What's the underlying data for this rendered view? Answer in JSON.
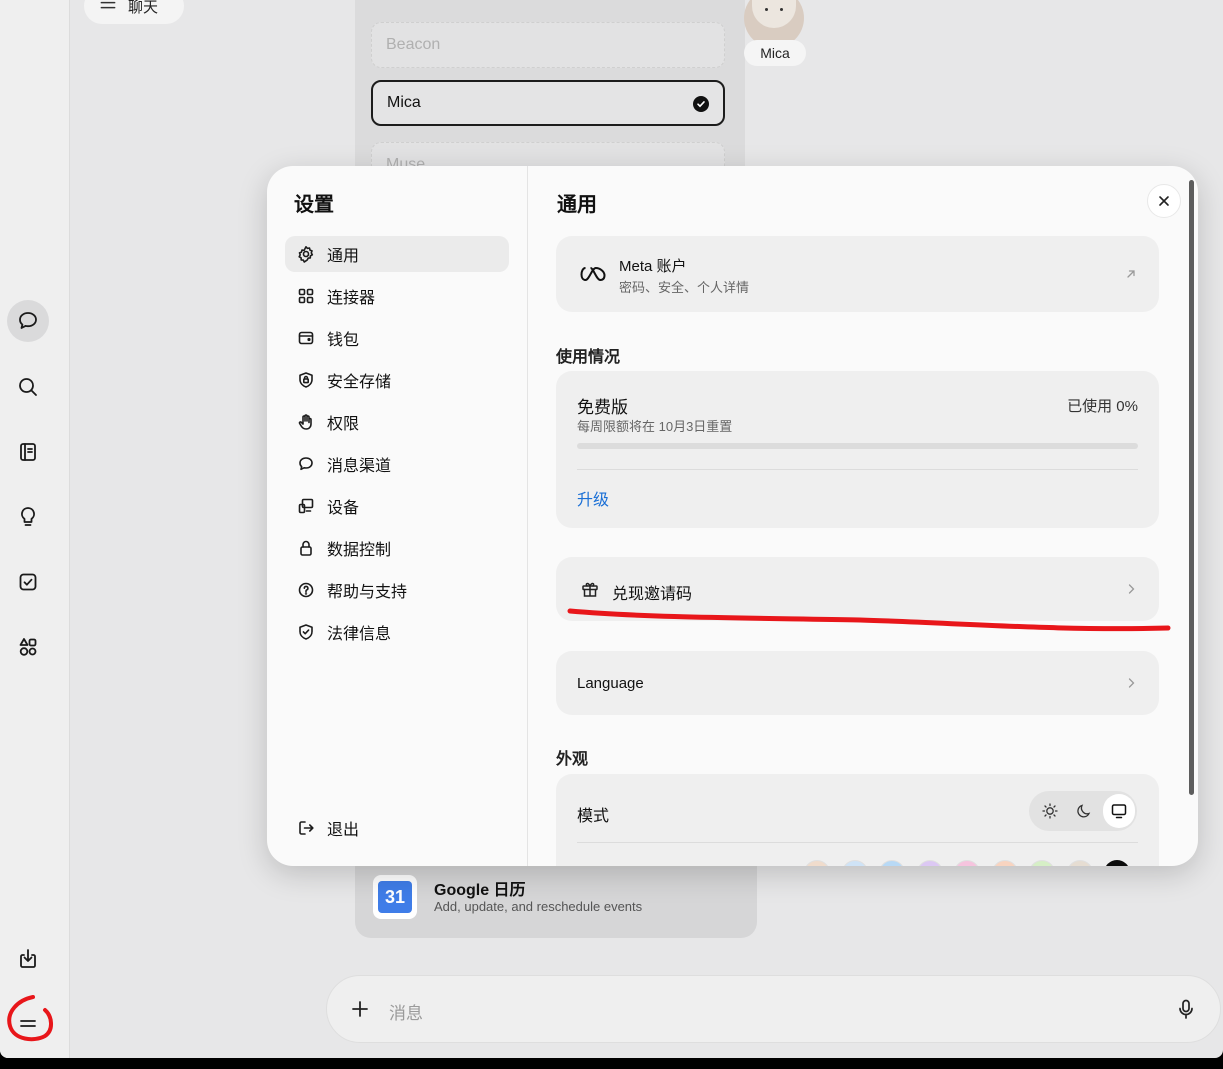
{
  "topbar": {
    "chat_label": "聊天"
  },
  "voices": {
    "options": [
      {
        "name": "Beacon"
      },
      {
        "name": "Mica"
      },
      {
        "name": "Muse"
      }
    ],
    "avatar_name": "Mica"
  },
  "connector_card": {
    "icon_text": "31",
    "title": "Google 日历",
    "subtitle": "Add, update, and reschedule events"
  },
  "composer": {
    "placeholder": "消息"
  },
  "settings": {
    "title": "设置",
    "nav": [
      {
        "label": "通用",
        "icon": "gear-icon"
      },
      {
        "label": "连接器",
        "icon": "grid-icon"
      },
      {
        "label": "钱包",
        "icon": "wallet-icon"
      },
      {
        "label": "安全存储",
        "icon": "shield-lock-icon"
      },
      {
        "label": "权限",
        "icon": "hand-icon"
      },
      {
        "label": "消息渠道",
        "icon": "chat-bubble-icon"
      },
      {
        "label": "设备",
        "icon": "devices-icon"
      },
      {
        "label": "数据控制",
        "icon": "lock-icon"
      },
      {
        "label": "帮助与支持",
        "icon": "help-icon"
      },
      {
        "label": "法律信息",
        "icon": "shield-check-icon"
      }
    ],
    "logout_label": "退出",
    "general": {
      "title": "通用",
      "account": {
        "title": "Meta 账户",
        "subtitle": "密码、安全、个人详情"
      },
      "usage_heading": "使用情况",
      "plan": {
        "name": "免费版",
        "reset_note": "每周限额将在 10月3日重置",
        "used_text": "已使用 0%",
        "used_fraction": 0.0,
        "upgrade_label": "升级"
      },
      "invite_label": "兑现邀请码",
      "language_label": "Language",
      "appearance_heading": "外观",
      "mode_label": "模式",
      "mode_options": [
        "sun-icon",
        "moon-icon",
        "monitor-icon"
      ],
      "mode_selected": "monitor-icon",
      "accent_colors": [
        "#f0dccc",
        "#cfe3f6",
        "#b8d9f5",
        "#dcc8f3",
        "#f6c4de",
        "#f8d4c0",
        "#d6efc6",
        "#e6ddd2",
        "#0b0b0b"
      ]
    }
  },
  "colors": {
    "accent_link": "#1a6fd6",
    "annotation": "#e8161a"
  }
}
